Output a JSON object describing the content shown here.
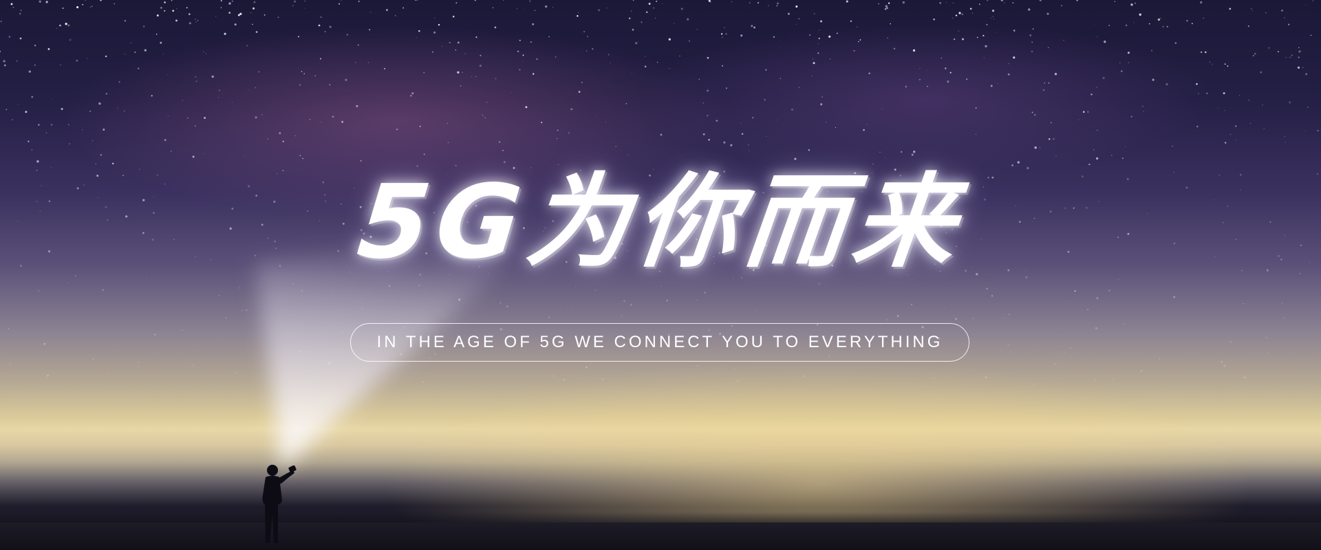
{
  "banner": {
    "title": "5G为你而来",
    "subtitle": "IN THE AGE OF 5G WE CONNECT YOU TO EVERYTHING"
  },
  "colors": {
    "sky_top": "#1b1837",
    "horizon_glow": "#e8d7a6",
    "ground": "#14131d",
    "text": "#ffffff"
  },
  "icons": {
    "person": "person-with-flashlight-silhouette-icon"
  }
}
